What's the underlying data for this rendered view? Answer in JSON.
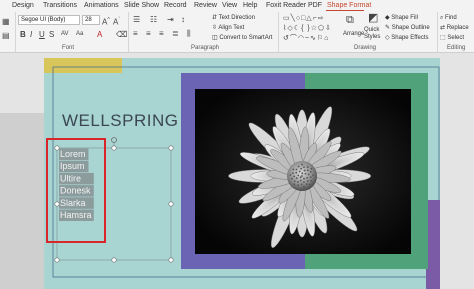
{
  "tabs": [
    "Design",
    "Transitions",
    "Animations",
    "Slide Show",
    "Record",
    "Review",
    "View",
    "Help",
    "Foxit Reader PDF",
    "Shape Format"
  ],
  "active_tab": "Shape Format",
  "ribbon": {
    "font_name": "Segoe UI (Body)",
    "font_size": "28",
    "text_direction": "Text Direction",
    "align_text": "Align Text",
    "convert_smartart": "Convert to SmartArt",
    "arrange": "Arrange",
    "quick_styles": "Quick Styles",
    "shape_fill": "Shape Fill",
    "shape_outline": "Shape Outline",
    "shape_effects": "Shape Effects",
    "find": "Find",
    "replace": "Replace",
    "select": "Select",
    "group_font": "Font",
    "group_paragraph": "Paragraph",
    "group_drawing": "Drawing",
    "group_editing": "Editing"
  },
  "slide": {
    "title": "WELLSPRING",
    "list_items": [
      "Lorem",
      "Ipsum",
      "Ultire",
      "Donesk",
      "Slarka",
      "Hamsra"
    ]
  },
  "colors": {
    "accent_tab": "#c4472d",
    "slide_bg": "#a8d4d1",
    "yellow_band": "#d9c65a",
    "purple_frame": "#6b64b4",
    "green_frame": "#4fa27a",
    "highlight_box": "#d9262b"
  }
}
